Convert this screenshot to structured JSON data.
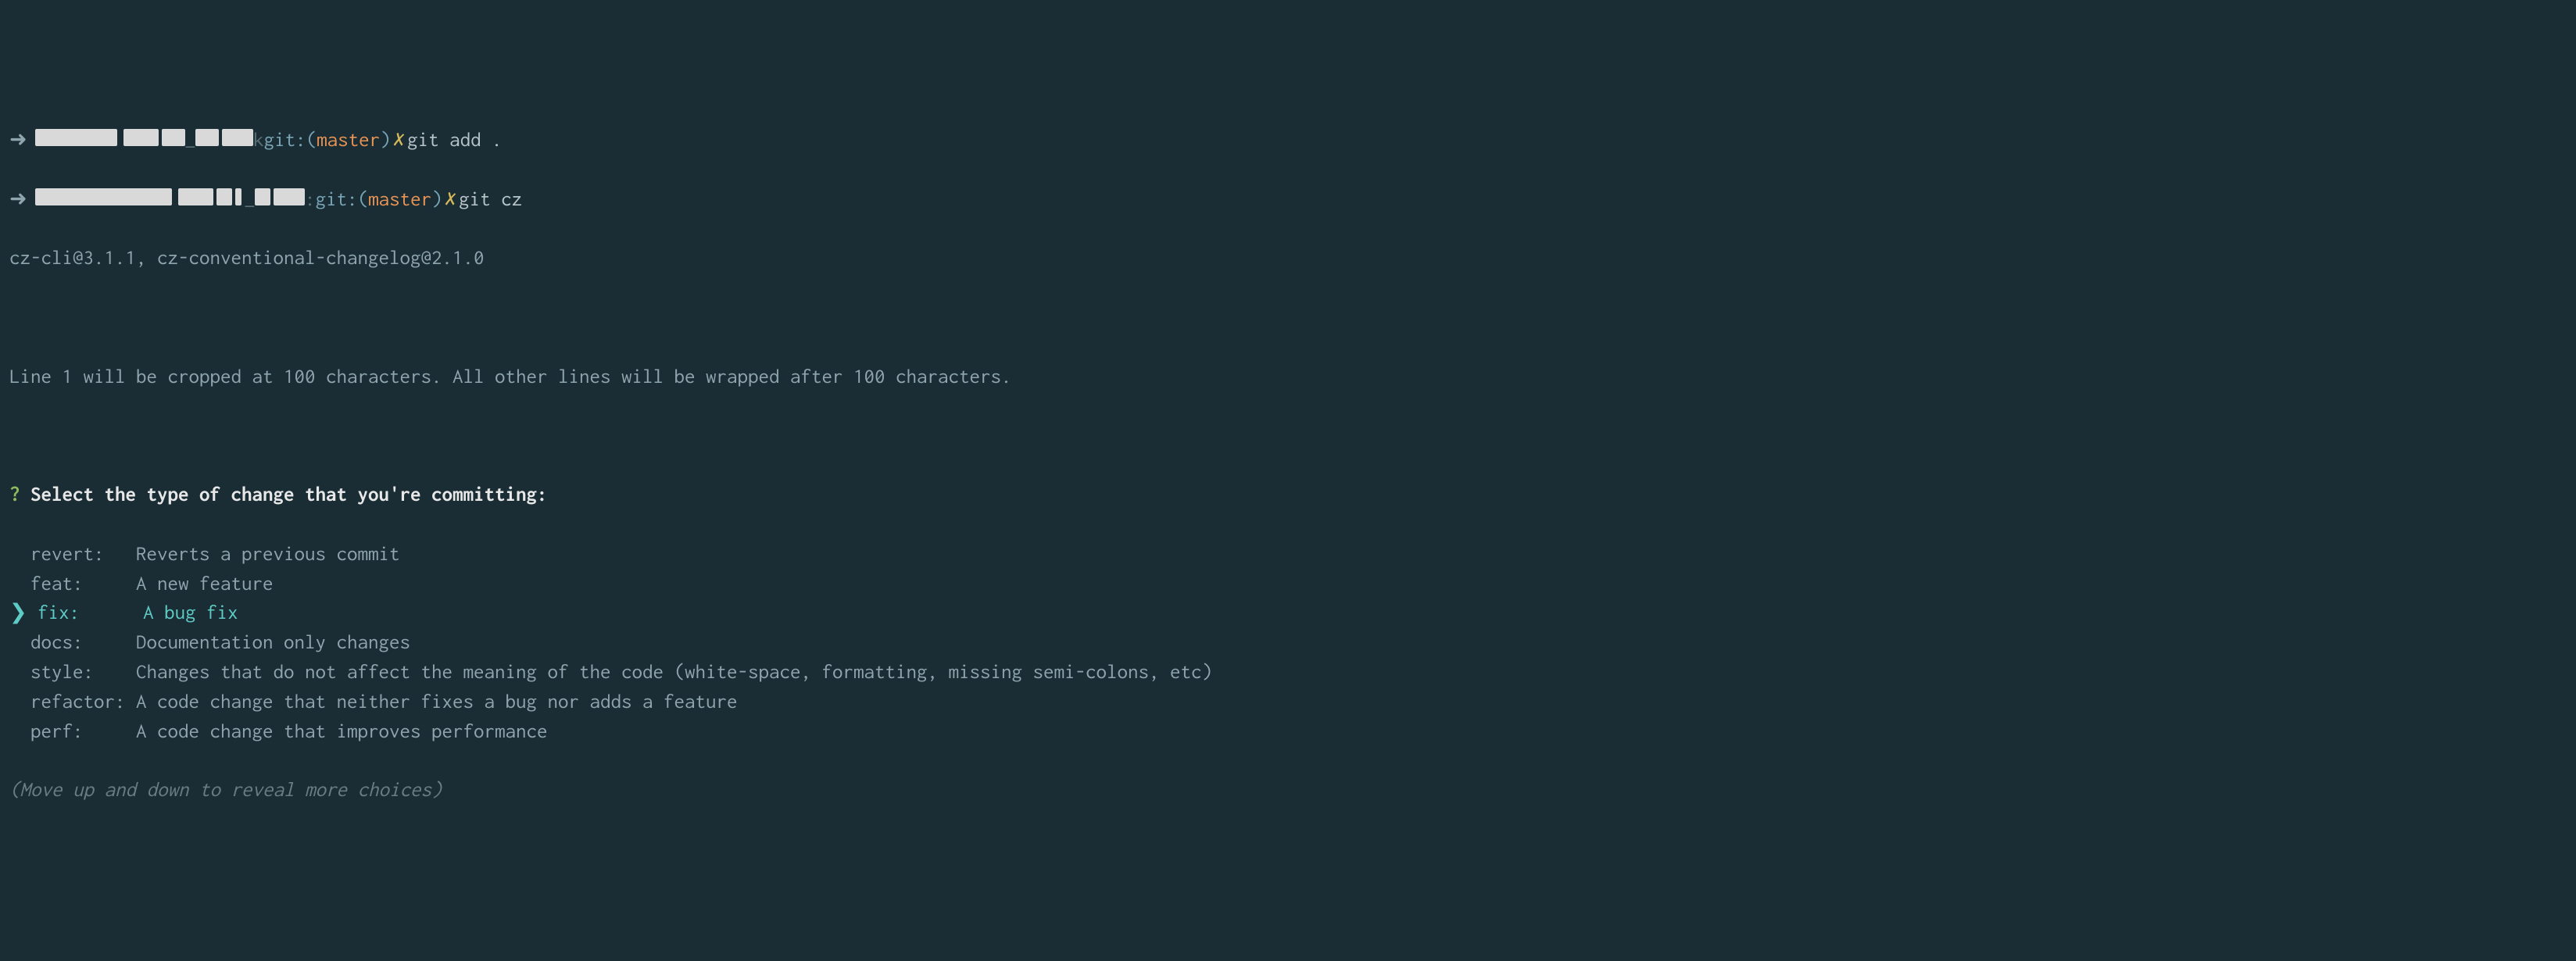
{
  "prompts": [
    {
      "git_prefix": "git:(",
      "branch": "master",
      "git_suffix": ")",
      "x": "✗",
      "command": "git add ."
    },
    {
      "git_prefix": "git:(",
      "branch": "master",
      "git_suffix": ")",
      "x": "✗",
      "command": "git cz"
    }
  ],
  "version_line": "cz-cli@3.1.1, cz-conventional-changelog@2.1.0",
  "info_line": "Line 1 will be cropped at 100 characters. All other lines will be wrapped after 100 characters.",
  "question_mark": "?",
  "question": "Select the type of change that you're committing:",
  "options": [
    {
      "pointer": " ",
      "type": "revert:  ",
      "desc": "Reverts a previous commit",
      "selected": false
    },
    {
      "pointer": " ",
      "type": "feat:    ",
      "desc": "A new feature",
      "selected": false
    },
    {
      "pointer": "❯",
      "type": "fix:     ",
      "desc": "A bug fix",
      "selected": true
    },
    {
      "pointer": " ",
      "type": "docs:    ",
      "desc": "Documentation only changes",
      "selected": false
    },
    {
      "pointer": " ",
      "type": "style:   ",
      "desc": "Changes that do not affect the meaning of the code (white-space, formatting, missing semi-colons, etc)",
      "selected": false
    },
    {
      "pointer": " ",
      "type": "refactor:",
      "desc": "A code change that neither fixes a bug nor adds a feature",
      "selected": false
    },
    {
      "pointer": " ",
      "type": "perf:    ",
      "desc": "A code change that improves performance",
      "selected": false
    }
  ],
  "hint": "(Move up and down to reveal more choices)",
  "dark_k": "k",
  "arrow": "➜"
}
